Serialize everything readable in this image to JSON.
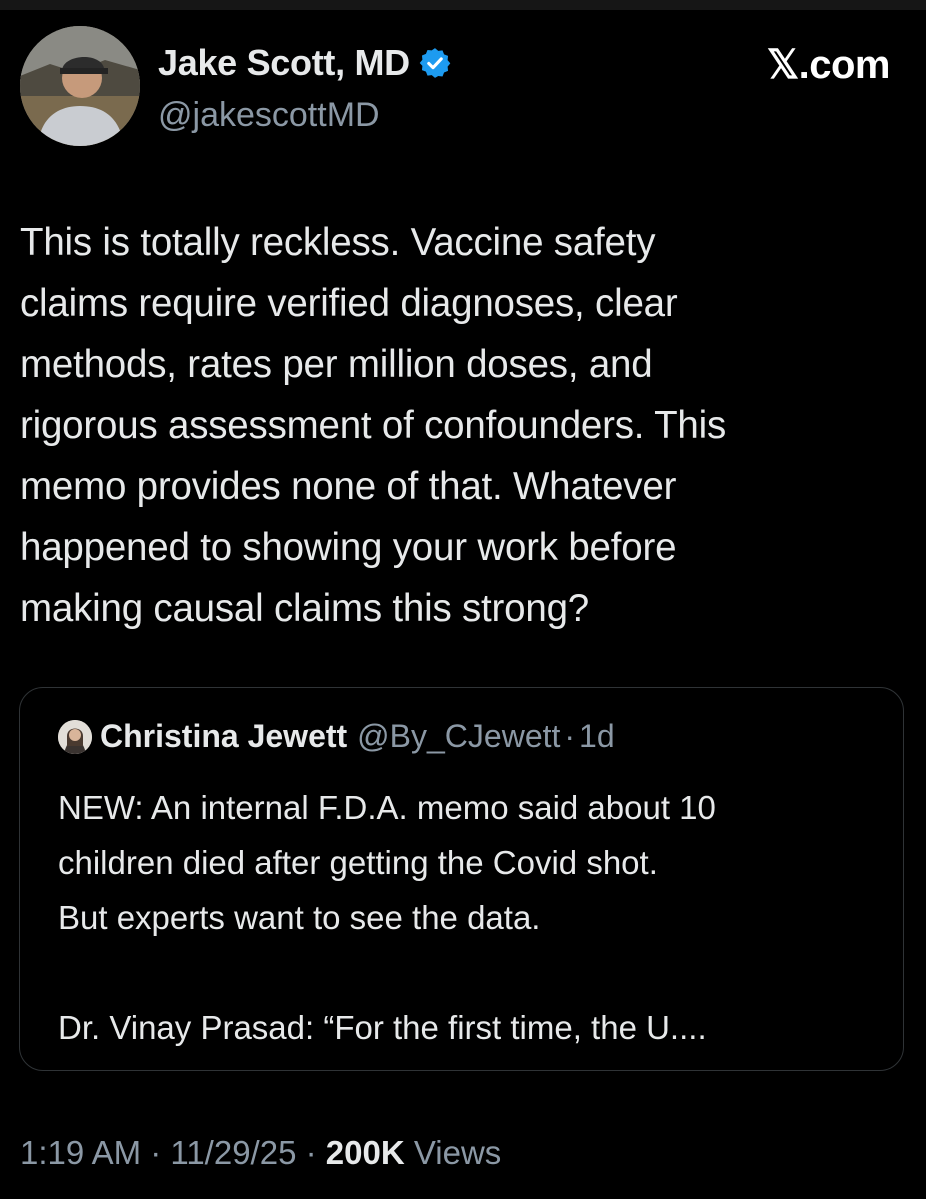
{
  "author": {
    "name": "Jake Scott, MD",
    "handle": "@jakescottMD",
    "verified_color": "#1d9bf0"
  },
  "source": "𝕏.com",
  "tweet": {
    "text": "This is totally reckless. Vaccine safety\nclaims require verified diagnoses, clear\nmethods, rates per million doses, and\nrigorous assessment of confounders. This\nmemo provides none of that. Whatever\nhappened to showing your work before\nmaking causal claims this strong?"
  },
  "quoted_tweet": {
    "author": "Christina Jewett",
    "handle": "@By_CJewett",
    "separator": "·",
    "time": "1d",
    "text": "NEW: An internal F.D.A. memo said about 10\nchildren died after getting the Covid shot.\nBut experts want to see the data.\n\nDr. Vinay Prasad: “For the first time, the U...."
  },
  "meta": {
    "time": "1:19 AM",
    "date": "11/29/25",
    "separator": "·",
    "views_count": "200K",
    "views_label": "Views"
  },
  "colors": {
    "background": "#000000",
    "text": "#e7e9ea",
    "secondary": "#8b98a5",
    "border": "#2f3336"
  }
}
